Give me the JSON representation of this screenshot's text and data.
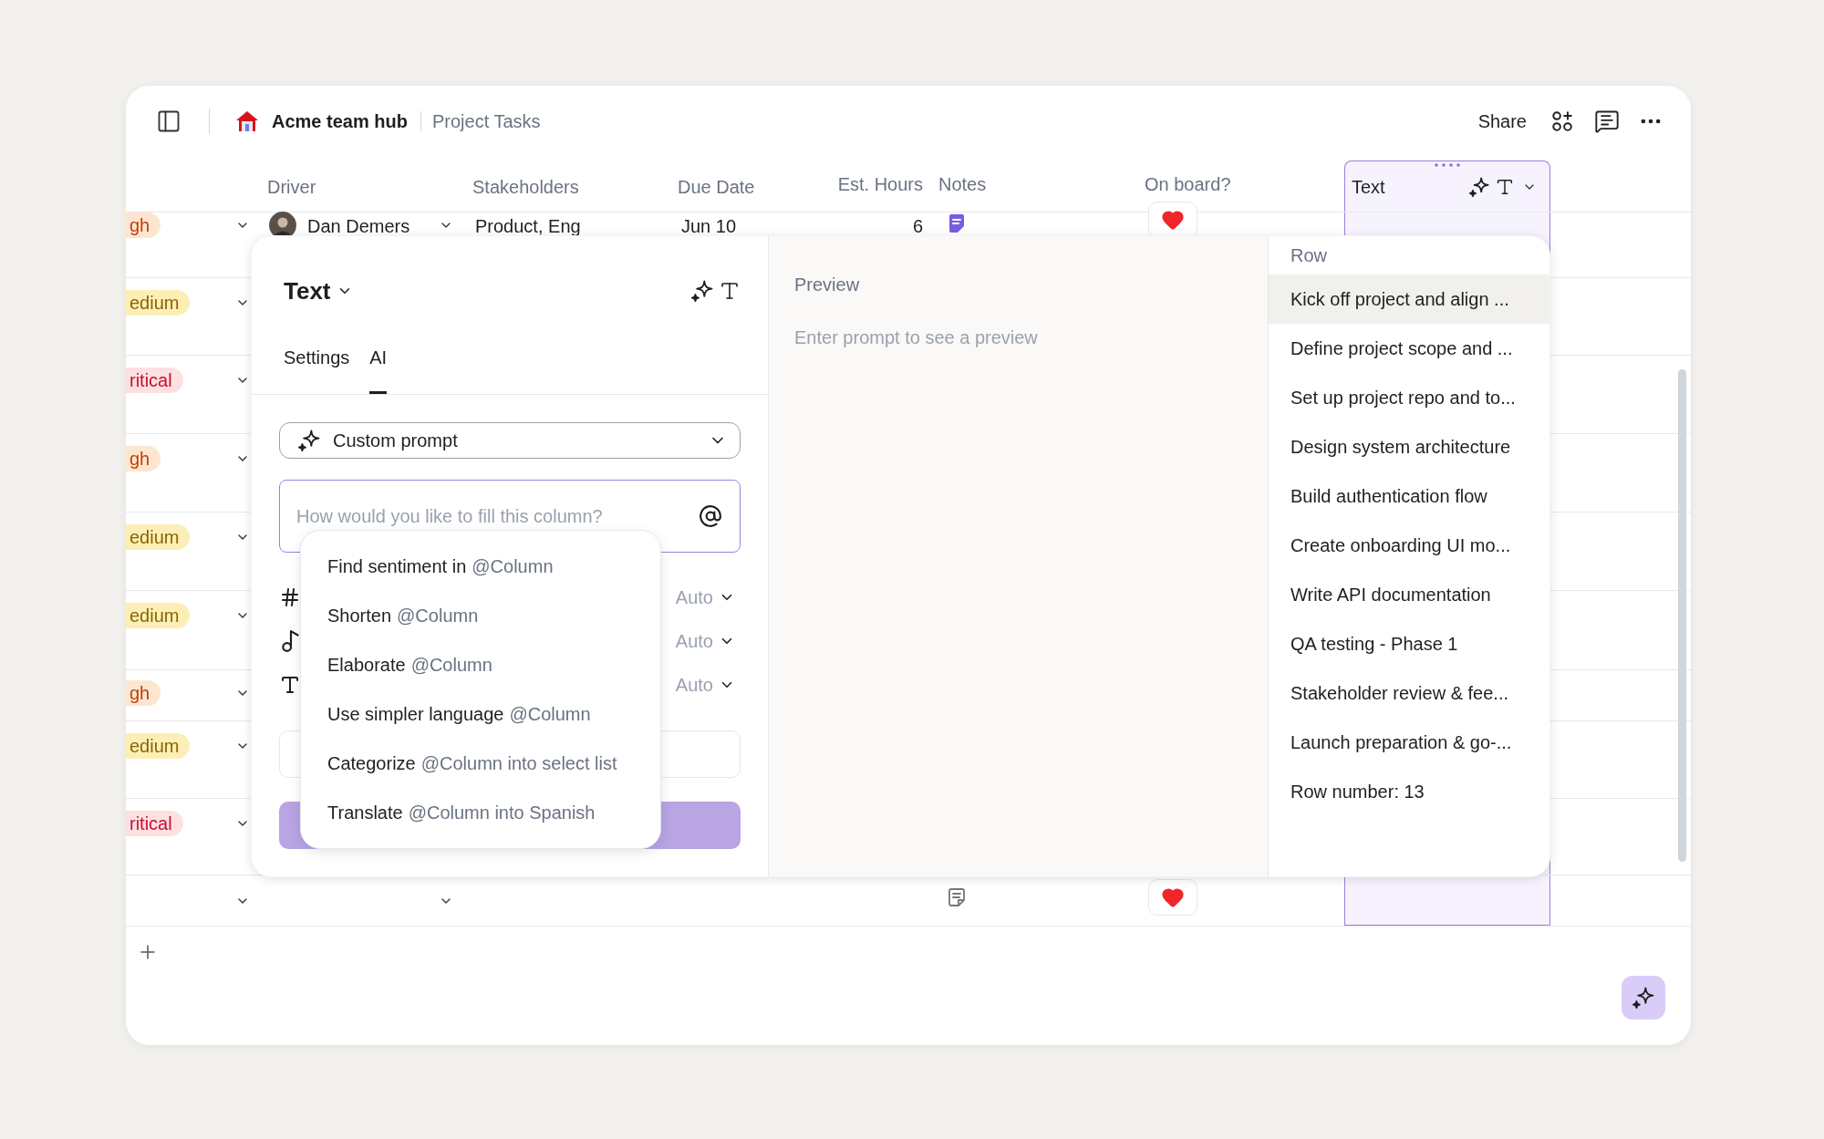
{
  "topbar": {
    "workspace": "Acme team hub",
    "page": "Project Tasks",
    "share": "Share"
  },
  "columns": [
    "Driver",
    "Stakeholders",
    "Due Date",
    "Est. Hours",
    "Notes",
    "On board?"
  ],
  "ai_column": {
    "label": "Text",
    "selected": true
  },
  "rows": [
    {
      "priority": {
        "text": "gh",
        "color": "#fde6cf"
      },
      "driver": "Dan Demers",
      "stakeholders": "Product, Eng",
      "due": "Jun 10",
      "hours": "6",
      "notes_filled": true,
      "on_board": true
    },
    {
      "priority": {
        "text": "edium",
        "color": "#fcefb6"
      }
    },
    {
      "priority": {
        "text": "ritical",
        "color": "#fde0e2"
      }
    },
    {
      "priority": {
        "text": "gh",
        "color": "#fde6cf"
      }
    },
    {
      "priority": {
        "text": "edium",
        "color": "#fcefb6"
      }
    },
    {
      "priority": {
        "text": "edium",
        "color": "#fcefb6"
      }
    },
    {
      "priority": {
        "text": "gh",
        "color": "#fde6cf"
      }
    },
    {
      "priority": {
        "text": "edium",
        "color": "#fcefb6"
      }
    },
    {
      "priority": {
        "text": "ritical",
        "color": "#fde0e2"
      }
    },
    {
      "notes_filled": false,
      "on_board": true
    }
  ],
  "popover": {
    "type_label": "Text",
    "tabs": [
      {
        "label": "Settings",
        "selected": false
      },
      {
        "label": "AI",
        "selected": true
      }
    ],
    "prompt_type": "Custom prompt",
    "prompt": {
      "placeholder": "How would you like to fill this column?"
    },
    "options": [
      {
        "kind": "number",
        "value": "Auto"
      },
      {
        "kind": "audio",
        "value": "Auto"
      },
      {
        "kind": "text",
        "value": "Auto"
      }
    ],
    "suggestions": [
      {
        "action": "Find sentiment in",
        "target": "@Column"
      },
      {
        "action": "Shorten",
        "target": "@Column"
      },
      {
        "action": "Elaborate",
        "target": "@Column"
      },
      {
        "action": "Use simpler language",
        "target": "@Column"
      },
      {
        "action": "Categorize",
        "target": "@Column into select list"
      },
      {
        "action": "Translate",
        "target": "@Column into Spanish"
      }
    ],
    "preview": {
      "title": "Preview",
      "hint": "Enter prompt to see a preview"
    },
    "row_list": {
      "title": "Row",
      "items": [
        {
          "label": "Kick off project and align ...",
          "selected": true
        },
        {
          "label": "Define project scope and ...",
          "selected": false
        },
        {
          "label": "Set up project repo and to...",
          "selected": false
        },
        {
          "label": "Design system architecture",
          "selected": false
        },
        {
          "label": "Build authentication flow",
          "selected": false
        },
        {
          "label": "Create onboarding UI mo...",
          "selected": false
        },
        {
          "label": "Write API documentation",
          "selected": false
        },
        {
          "label": "QA testing - Phase 1",
          "selected": false
        },
        {
          "label": "Stakeholder review & fee...",
          "selected": false
        },
        {
          "label": "Launch preparation & go-...",
          "selected": false
        },
        {
          "label": "Row number: 13",
          "selected": false
        }
      ]
    }
  }
}
